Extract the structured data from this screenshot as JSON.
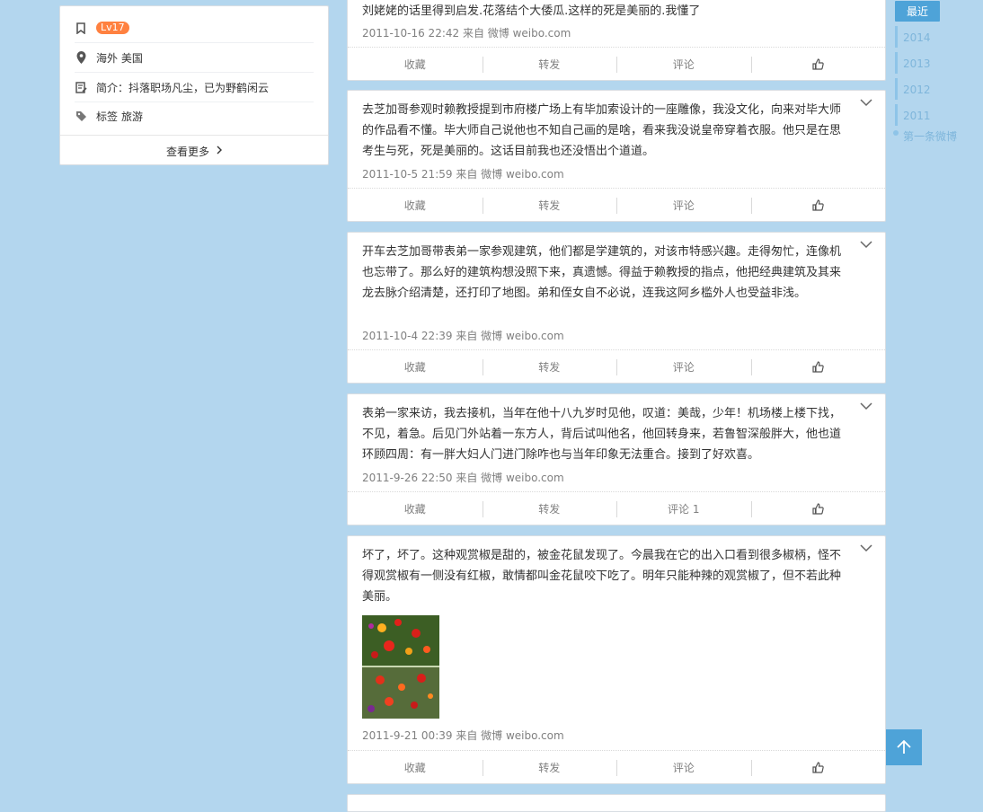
{
  "profile": {
    "level": "Lv17",
    "location": "海外 美国",
    "bio": "简介：抖落职场凡尘，已为野鹤闲云",
    "tags_label": "标签",
    "tag": "旅游",
    "more": "查看更多"
  },
  "actions": {
    "favorite": "收藏",
    "forward": "转发",
    "comment": "评论"
  },
  "posts": [
    {
      "text": "刘姥姥的话里得到启发.花落结个大倭瓜.这样的死是美丽的.我懂了",
      "meta": "2011-10-16 22:42 来自 微博 weibo.com",
      "comment": "评论"
    },
    {
      "text": "去芝加哥参观时赖教授提到市府楼广场上有毕加索设计的一座雕像，我没文化，向来对毕大师的作品看不懂。毕大师自己说他也不知自己画的是啥，看来我没说皇帝穿着衣服。他只是在思考生与死，死是美丽的。这话目前我也还没悟出个道道。",
      "meta": "2011-10-5 21:59 来自 微博 weibo.com",
      "comment": "评论"
    },
    {
      "text": "开车去芝加哥带表弟一家参观建筑，他们都是学建筑的，对该市特感兴趣。走得匆忙，连像机也忘带了。那么好的建筑构想没照下来，真遗憾。得益于赖教授的指点，他把经典建筑及其来龙去脉介绍清楚，还打印了地图。弟和侄女自不必说，连我这阿乡槛外人也受益非浅。",
      "meta": "2011-10-4 22:39 来自 微博 weibo.com",
      "comment": "评论"
    },
    {
      "text": "表弟一家来访，我去接机，当年在他十八九岁时见他，叹道：美哉，少年！机场楼上楼下找，不见，着急。后见门外站着一东方人，背后试叫他名，他回转身来，若鲁智深般胖大，他也道环顾四周：有一胖大妇人门进门除咋也与当年印象无法重合。接到了好欢喜。",
      "meta": "2011-9-26 22:50 来自 微博 weibo.com",
      "comment": "评论 1"
    },
    {
      "text": "坏了，坏了。这种观赏椒是甜的，被金花鼠发现了。今晨我在它的出入口看到很多椒柄，怪不得观赏椒有一侧没有红椒，敢情都叫金花鼠咬下吃了。明年只能种辣的观赏椒了，但不若此种美丽。",
      "meta": "2011-9-21 00:39 来自 微博 weibo.com",
      "comment": "评论"
    }
  ],
  "timeline": {
    "current": "最近",
    "years": [
      "2014",
      "2013",
      "2012",
      "2011"
    ],
    "first": "第一条微博"
  }
}
